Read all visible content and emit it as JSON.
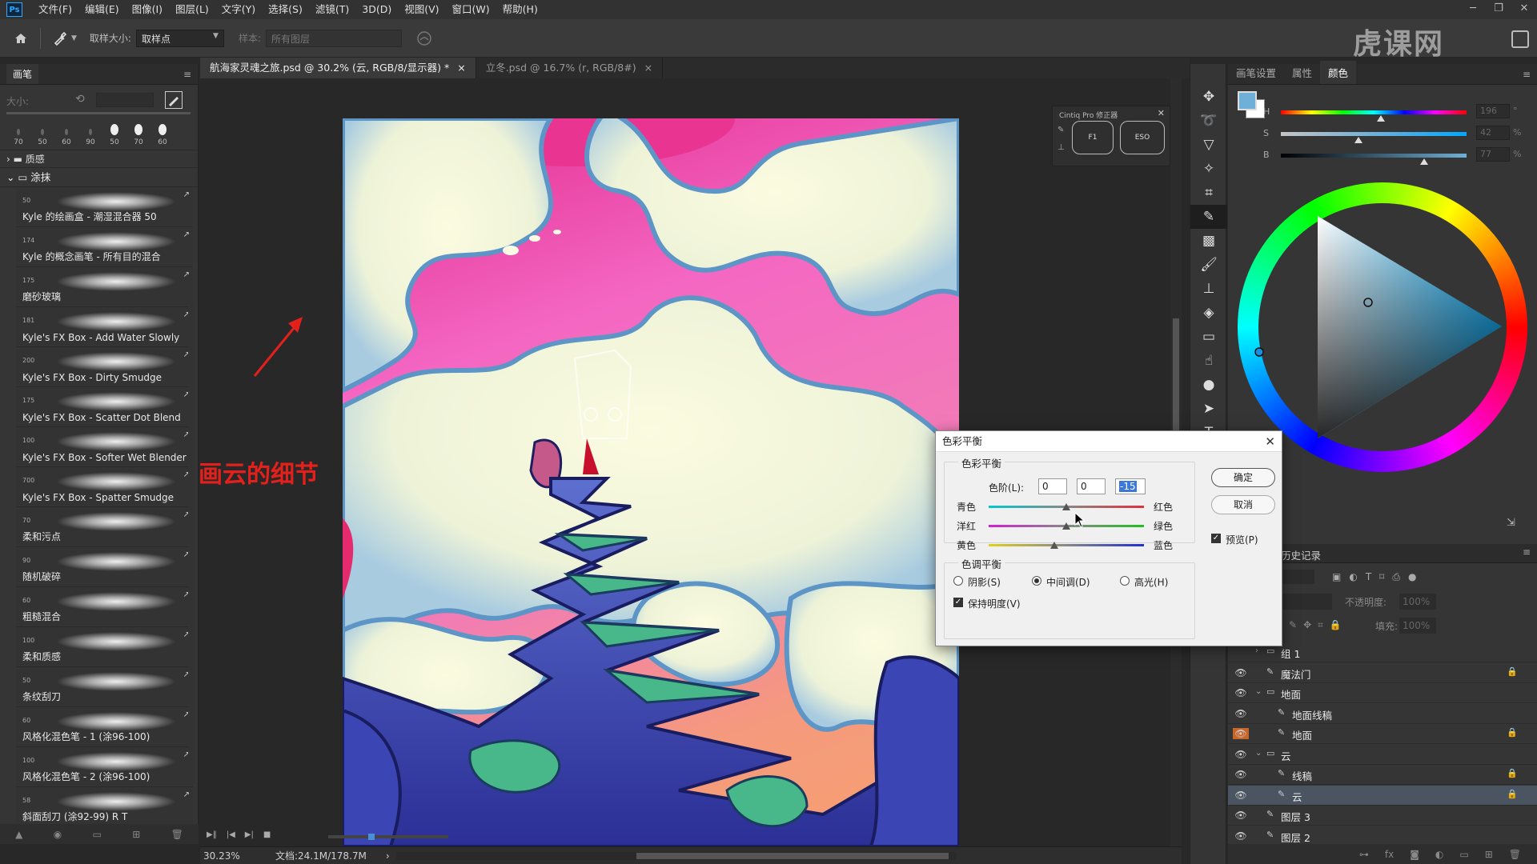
{
  "app": {
    "logo": "Ps"
  },
  "menu": [
    "文件(F)",
    "编辑(E)",
    "图像(I)",
    "图层(L)",
    "文字(Y)",
    "选择(S)",
    "滤镜(T)",
    "3D(D)",
    "视图(V)",
    "窗口(W)",
    "帮助(H)"
  ],
  "options": {
    "sample_size_label": "取样大小:",
    "sample_size_value": "取样点",
    "sample_label": "样本:",
    "sample_value": "所有图层"
  },
  "watermark": "虎课网",
  "brush_panel": {
    "title": "画笔",
    "size_label": "大小:",
    "preset_sizes": [
      "70",
      "50",
      "60",
      "90",
      "50",
      "70",
      "60"
    ],
    "group_collapsed": "质感",
    "group_open": "涂抹",
    "brushes": [
      {
        "size": "50",
        "name": "Kyle 的绘画盒 - 潮湿混合器 50"
      },
      {
        "size": "174",
        "name": "Kyle 的概念画笔 - 所有目的混合"
      },
      {
        "size": "175",
        "name": "磨砂玻璃"
      },
      {
        "size": "181",
        "name": "Kyle's FX Box - Add Water Slowly"
      },
      {
        "size": "200",
        "name": "Kyle's FX Box - Dirty Smudge"
      },
      {
        "size": "175",
        "name": "Kyle's FX Box - Scatter Dot Blend"
      },
      {
        "size": "100",
        "name": "Kyle's FX Box - Softer Wet Blender"
      },
      {
        "size": "700",
        "name": "Kyle's FX Box - Spatter Smudge"
      },
      {
        "size": "70",
        "name": "柔和污点"
      },
      {
        "size": "90",
        "name": "随机破碎"
      },
      {
        "size": "60",
        "name": "粗糙混合"
      },
      {
        "size": "100",
        "name": "柔和质感"
      },
      {
        "size": "50",
        "name": "条纹刮刀"
      },
      {
        "size": "60",
        "name": "风格化混色笔 - 1 (涂96-100)"
      },
      {
        "size": "100",
        "name": "风格化混色笔 - 2 (涂96-100)"
      },
      {
        "size": "58",
        "name": "斜面刮刀 (涂92-99) R T"
      }
    ]
  },
  "doc_tabs": [
    {
      "label": "航海家灵魂之旅.psd @ 30.2% (云, RGB/8/显示器) *",
      "close": "×"
    },
    {
      "label": "立冬.psd @ 16.7% (r, RGB/8#)",
      "close": "×"
    }
  ],
  "annotation": {
    "text": "画云的细节",
    "color": "#e3201b"
  },
  "wacom": {
    "title": "Cintiq Pro 修正器",
    "btn1": "F1",
    "btn2": "ESO",
    "close": "✕"
  },
  "status": {
    "zoom": "30.23%",
    "doc": "文档:24.1M/178.7M",
    "arrow": "›"
  },
  "right_tabs": [
    "画笔设置",
    "属性",
    "颜色"
  ],
  "color": {
    "fg": "#6fb0d8",
    "bg": "#ffffff",
    "H": {
      "label": "H",
      "value": "196",
      "unit": "°",
      "pos": 0.54
    },
    "S": {
      "label": "S",
      "value": "42",
      "unit": "%",
      "pos": 0.42
    },
    "B": {
      "label": "B",
      "value": "77",
      "unit": "%",
      "pos": 0.77
    }
  },
  "history_tab": "历史记录",
  "layer_opts": {
    "opacity_label": "不透明度:",
    "opacity_value": "100%",
    "fill_label": "填充:",
    "fill_value": "100%"
  },
  "layers": [
    {
      "name": "组 1",
      "type": "group",
      "indent": 0,
      "visible": false,
      "lock": false,
      "sel": false
    },
    {
      "name": "魔法门",
      "type": "layer",
      "indent": 0,
      "visible": true,
      "lock": true,
      "sel": false
    },
    {
      "name": "地面",
      "type": "group",
      "indent": 0,
      "visible": true,
      "lock": false,
      "sel": false
    },
    {
      "name": "地面线稿",
      "type": "layer",
      "indent": 1,
      "visible": true,
      "lock": false,
      "sel": false
    },
    {
      "name": "地面",
      "type": "layer",
      "indent": 1,
      "visible": true,
      "lock": true,
      "sel": false,
      "orange": true
    },
    {
      "name": "云",
      "type": "group",
      "indent": 0,
      "visible": true,
      "lock": false,
      "sel": false
    },
    {
      "name": "线稿",
      "type": "layer",
      "indent": 1,
      "visible": true,
      "lock": true,
      "sel": false
    },
    {
      "name": "云",
      "type": "layer",
      "indent": 1,
      "visible": true,
      "lock": true,
      "sel": true
    },
    {
      "name": "图层 3",
      "type": "layer",
      "indent": 0,
      "visible": true,
      "lock": false,
      "sel": false
    },
    {
      "name": "图层 2",
      "type": "layer",
      "indent": 0,
      "visible": true,
      "lock": false,
      "sel": false
    }
  ],
  "dialog": {
    "title": "色彩平衡",
    "close": "✕",
    "grp1": "色彩平衡",
    "levels_label": "色阶(L):",
    "levels": [
      "0",
      "0",
      "-15"
    ],
    "rows": [
      {
        "left": "青色",
        "right": "红色",
        "pos": 0.5
      },
      {
        "left": "洋红",
        "right": "绿色",
        "pos": 0.5
      },
      {
        "left": "黄色",
        "right": "蓝色",
        "pos": 0.425
      }
    ],
    "grp2": "色调平衡",
    "shadows": "阴影(S)",
    "midtones": "中间调(D)",
    "highlights": "高光(H)",
    "preserve": "保持明度(V)",
    "ok": "确定",
    "cancel": "取消",
    "preview": "预览(P)"
  }
}
